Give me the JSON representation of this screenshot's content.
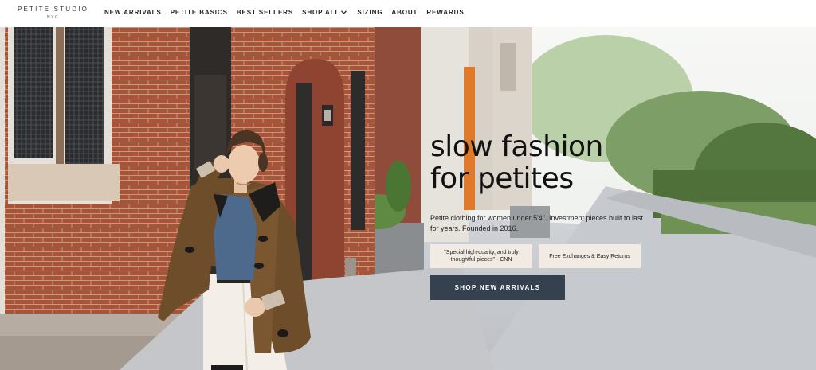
{
  "brand": {
    "name": "PETITE STUDIO",
    "sub": "NYC"
  },
  "nav": {
    "items": [
      {
        "label": "NEW ARRIVALS"
      },
      {
        "label": "PETITE BASICS"
      },
      {
        "label": "BEST SELLERS"
      },
      {
        "label": "SHOP ALL",
        "icon": "chevron-down-icon"
      },
      {
        "label": "SIZING"
      },
      {
        "label": "ABOUT"
      },
      {
        "label": "REWARDS"
      }
    ]
  },
  "hero": {
    "headline_line1": "slow fashion",
    "headline_line2": "for petites",
    "subtitle": "Petite clothing for women under 5'4\". Investment pieces built to last for years. Founded in 2016.",
    "badges": [
      {
        "text": "\"Special high-quality, and truly thoughtful pieces\" - CNN"
      },
      {
        "text": "Free Exchanges & Easy Returns"
      }
    ],
    "cta_label": "SHOP NEW ARRIVALS"
  },
  "colors": {
    "cta_bg": "#36414f",
    "badge_bg": "#f1ebe3",
    "brick": "#a85438"
  }
}
